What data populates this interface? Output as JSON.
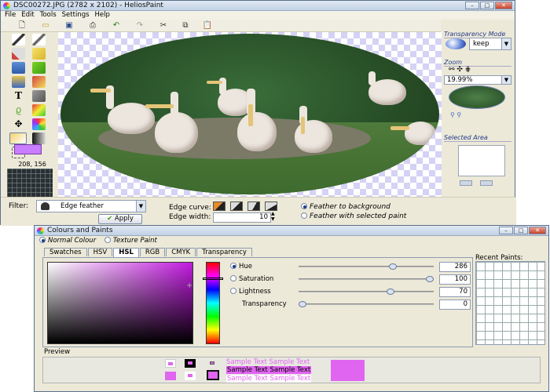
{
  "main_window": {
    "title": "DSC00272.JPG (2782 x 2102) - HeliosPaint",
    "menu": [
      "File",
      "Edit",
      "Tools",
      "Settings",
      "Help"
    ],
    "coords_readout": "208, 156"
  },
  "right_panel": {
    "transparency_title": "Transparency Mode",
    "transparency_value": "keep",
    "zoom_title": "Zoom",
    "zoom_value": "19.99%",
    "selected_area_title": "Selected Area"
  },
  "bottom_bar": {
    "filter_label": "Filter:",
    "filter_value": "Edge feather",
    "apply_label": "Apply",
    "edge_curve_label": "Edge curve:",
    "edge_width_label": "Edge width:",
    "edge_width_value": "10",
    "feather_bg": "Feather to background",
    "feather_sel": "Feather with selected paint"
  },
  "colours_window": {
    "title": "Colours and Paints",
    "mode_normal": "Normal Colour",
    "mode_texture": "Texture Paint",
    "tabs": [
      "Swatches",
      "HSV",
      "HSL",
      "RGB",
      "CMYK",
      "Transparency"
    ],
    "active_tab": "HSL",
    "sliders": [
      {
        "label": "Hue",
        "value": "286",
        "fraction": 0.71
      },
      {
        "label": "Saturation",
        "value": "100",
        "fraction": 1.0
      },
      {
        "label": "Lightness",
        "value": "70",
        "fraction": 0.69
      },
      {
        "label": "Transparency",
        "value": "0",
        "fraction": 0.0
      }
    ],
    "recent_label": "Recent Paints:",
    "preview_label": "Preview",
    "sample_text": "Sample Text",
    "current_colour": "#e065f0"
  }
}
